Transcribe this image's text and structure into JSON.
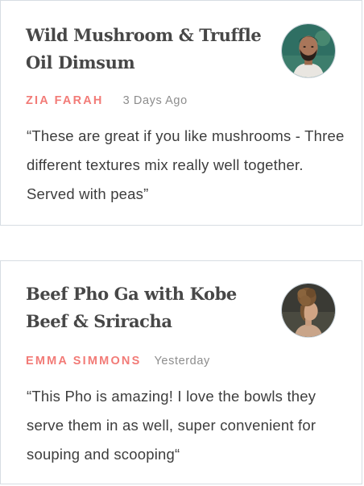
{
  "reviews": [
    {
      "dish_title": "Wild Mushroom & Truffle Oil Dimsum",
      "author": "ZIA FARAH",
      "time": "3 Days Ago",
      "text": "“These are great if you like mushrooms - Three different textures mix really well together. Served with peas”"
    },
    {
      "dish_title": "Beef Pho Ga with Kobe Beef & Sriracha",
      "author": "EMMA SIMMONS",
      "time": "Yesterday",
      "text": "“This Pho is amazing! I love the bowls they serve them in as well, super convenient for souping and scooping“"
    }
  ],
  "colors": {
    "author_accent": "#f27b77",
    "timestamp": "#8d8d8d",
    "title": "#474747",
    "body_text": "#3d3d3d",
    "card_border": "#d7dde3"
  },
  "icons": [
    "avatar-photo-man",
    "avatar-photo-woman"
  ]
}
